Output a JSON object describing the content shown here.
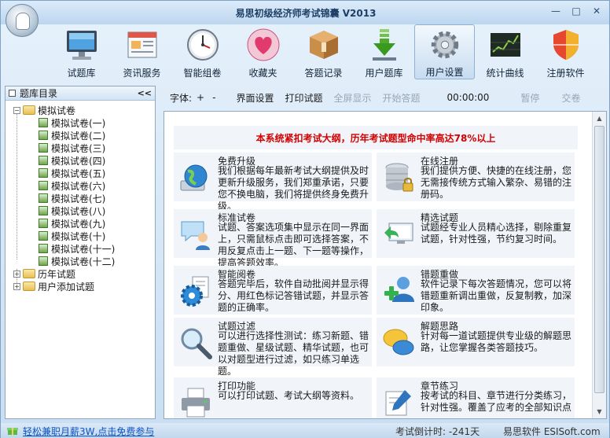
{
  "window": {
    "title": "易思初级经济师考试锦囊 V2013",
    "minimize": "—",
    "maximize": "□",
    "close": "✕"
  },
  "toolbar": {
    "items": [
      {
        "label": "试题库",
        "icon": "monitor-icon"
      },
      {
        "label": "资讯服务",
        "icon": "newspaper-icon"
      },
      {
        "label": "智能组卷",
        "icon": "clock-icon"
      },
      {
        "label": "收藏夹",
        "icon": "heart-icon"
      },
      {
        "label": "答题记录",
        "icon": "box-icon"
      },
      {
        "label": "用户题库",
        "icon": "download-arrow-icon"
      },
      {
        "label": "用户设置",
        "icon": "gear-icon"
      },
      {
        "label": "统计曲线",
        "icon": "chart-icon"
      },
      {
        "label": "注册软件",
        "icon": "shield-icon"
      }
    ],
    "active_index": 6
  },
  "sidebar": {
    "title": "题库目录",
    "collapse": "<<",
    "root": "模拟试卷",
    "papers": [
      "模拟试卷(一)",
      "模拟试卷(二)",
      "模拟试卷(三)",
      "模拟试卷(四)",
      "模拟试卷(五)",
      "模拟试卷(六)",
      "模拟试卷(七)",
      "模拟试卷(八)",
      "模拟试卷(九)",
      "模拟试卷(十)",
      "模拟试卷(十一)",
      "模拟试卷(十二)"
    ],
    "other_folders": [
      "历年试题",
      "用户添加试题"
    ]
  },
  "controls": {
    "font_label": "字体:",
    "font_plus": "+",
    "font_minus": "-",
    "layout": "界面设置",
    "print": "打印试题",
    "fullscreen": "全屏显示",
    "start": "开始答题",
    "timer": "00:00:00",
    "pause": "暂停",
    "submit": "交卷"
  },
  "banner": "本系统紧扣考试大纲，历年考试题型命中率高达78%以上",
  "features": [
    {
      "title": "免费升级",
      "desc": "我们根据每年最新考试大纲提供及时更新升级服务，我们郑重承诺，只要您不换电脑，我们将提供终身免费升级。",
      "icon": "globe-icon"
    },
    {
      "title": "在线注册",
      "desc": "我们提供方便、快捷的在线注册，您无需接传统方式输入繁杂、易错的注册码。",
      "icon": "database-lock-icon"
    },
    {
      "title": "标准试卷",
      "desc": "试题、答案选项集中显示在同一界面上，只需鼠标点击即可选择答案，不用反复点击上一题、下一题等操作，提高答题效率。",
      "icon": "chat-user-icon"
    },
    {
      "title": "精选试题",
      "desc": "试题经专业人员精心选择，剔除重复试题，针对性强，节约复习时间。",
      "icon": "screen-return-icon"
    },
    {
      "title": "智能阅卷",
      "desc": "答题完毕后，软件自动批阅并显示得分、用红色标记答错试题，并显示答题的正确率。",
      "icon": "gear-doc-icon"
    },
    {
      "title": "错题重做",
      "desc": "软件记录下每次答题情况，您可以将错题重新调出重做，反复制教，加深印象。",
      "icon": "user-add-icon"
    },
    {
      "title": "试题过滤",
      "desc": "可以进行选择性测试：练习新题、错题重做、星级试题、精华试题，也可以对题型进行过滤，如只练习单选题。",
      "icon": "magnifier-icon"
    },
    {
      "title": "解题思路",
      "desc": "针对每一道试题提供专业级的解题思路，让您掌握各类答题技巧。",
      "icon": "chat-bubbles-icon"
    },
    {
      "title": "打印功能",
      "desc": "可以打印试题、考试大纲等资料。",
      "icon": "printer-icon"
    },
    {
      "title": "章节练习",
      "desc": "按考试的科目、章节进行分类练习，针对性强。覆盖了应考的全部知识点",
      "icon": "pen-doc-icon"
    }
  ],
  "status": {
    "promo": "轻松兼职月薪3W,点击免费参与",
    "countdown": "考试倒计时: -241天",
    "brand": "易思软件 ESISoft.com"
  }
}
